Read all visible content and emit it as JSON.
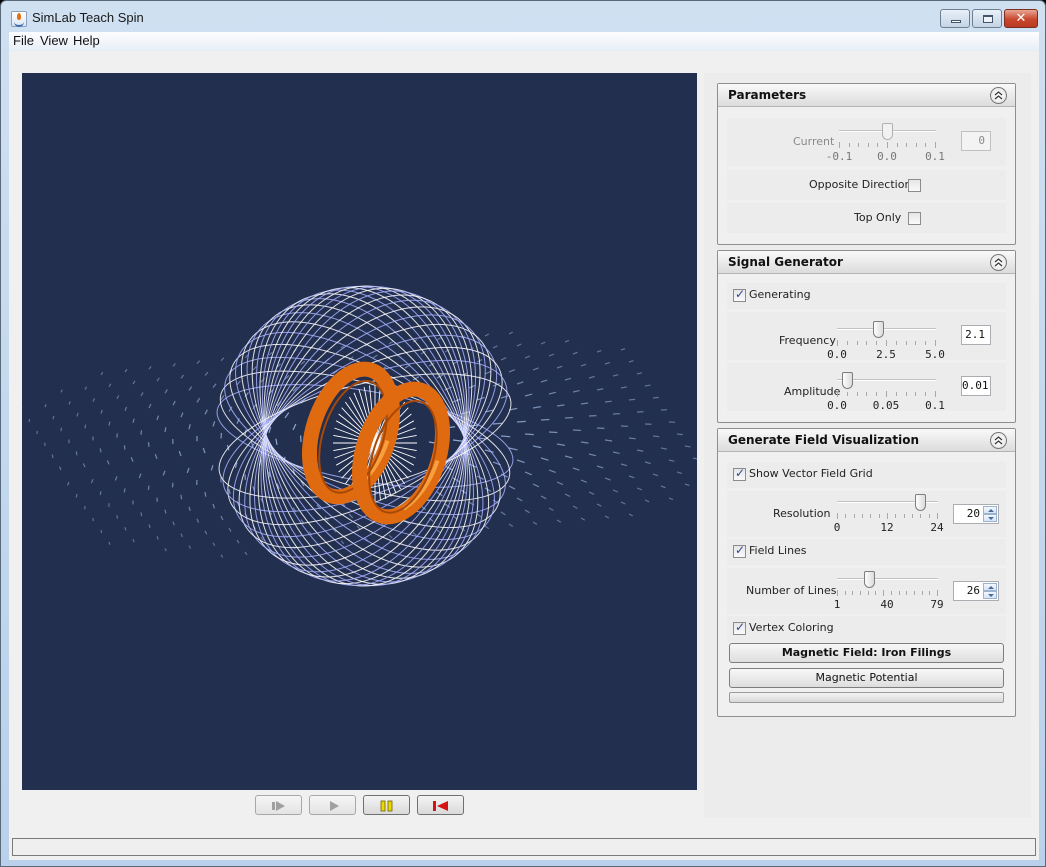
{
  "window": {
    "title": "SimLab Teach Spin",
    "controls": {
      "minimize": "minimize",
      "maximize": "maximize",
      "close": "✕"
    }
  },
  "menubar": {
    "items": [
      "File",
      "View",
      "Help"
    ]
  },
  "viewport": {
    "background": "#232f4f",
    "coil_color": "#e06a10",
    "field_line_color": "#aab2ff",
    "vector_color": "#a9c6f2"
  },
  "playback": {
    "buttons": [
      {
        "name": "step-forward",
        "icon": "step-forward-icon",
        "enabled": false
      },
      {
        "name": "play",
        "icon": "play-icon",
        "enabled": false
      },
      {
        "name": "pause",
        "icon": "pause-icon",
        "enabled": true,
        "color": "#e6d400"
      },
      {
        "name": "reset",
        "icon": "reset-icon",
        "enabled": true,
        "color": "#d01818"
      }
    ]
  },
  "panels": {
    "parameters": {
      "title": "Parameters",
      "current": {
        "label": "Current",
        "value": "0",
        "enabled": false,
        "min": -0.1,
        "max": 0.1,
        "position": 0.0,
        "tick_labels": [
          "-0.1",
          "0.0",
          "0.1"
        ]
      },
      "opposite_direction": {
        "label": "Opposite Direction",
        "checked": false
      },
      "top_only": {
        "label": "Top Only",
        "checked": false
      }
    },
    "signal_generator": {
      "title": "Signal Generator",
      "generating": {
        "label": "Generating",
        "checked": true
      },
      "frequency": {
        "label": "Frequency",
        "value": "2.1",
        "min": 0.0,
        "max": 5.0,
        "position": 2.1,
        "tick_labels": [
          "0.0",
          "2.5",
          "5.0"
        ]
      },
      "amplitude": {
        "label": "Amplitude",
        "value": "0.01",
        "min": 0.0,
        "max": 0.1,
        "position": 0.01,
        "tick_labels": [
          "0.0",
          "0.05",
          "0.1"
        ]
      }
    },
    "field_visualization": {
      "title": "Generate Field Visualization",
      "show_vector_field_grid": {
        "label": "Show Vector Field Grid",
        "checked": true
      },
      "resolution": {
        "label": "Resolution",
        "value": "20",
        "min": 0,
        "max": 24,
        "position": 20,
        "tick_labels": [
          "0",
          "12",
          "24"
        ]
      },
      "field_lines": {
        "label": "Field Lines",
        "checked": true
      },
      "number_of_lines": {
        "label": "Number of Lines",
        "value": "26",
        "min": 1,
        "max": 79,
        "position": 26,
        "tick_labels": [
          "1",
          "40",
          "79"
        ]
      },
      "vertex_coloring": {
        "label": "Vertex Coloring",
        "checked": true
      },
      "magnetic_field_button": "Magnetic Field:  Iron Filings",
      "magnetic_potential_button": "Magnetic Potential",
      "progress": 0
    }
  },
  "statusbar": {
    "text": ""
  }
}
